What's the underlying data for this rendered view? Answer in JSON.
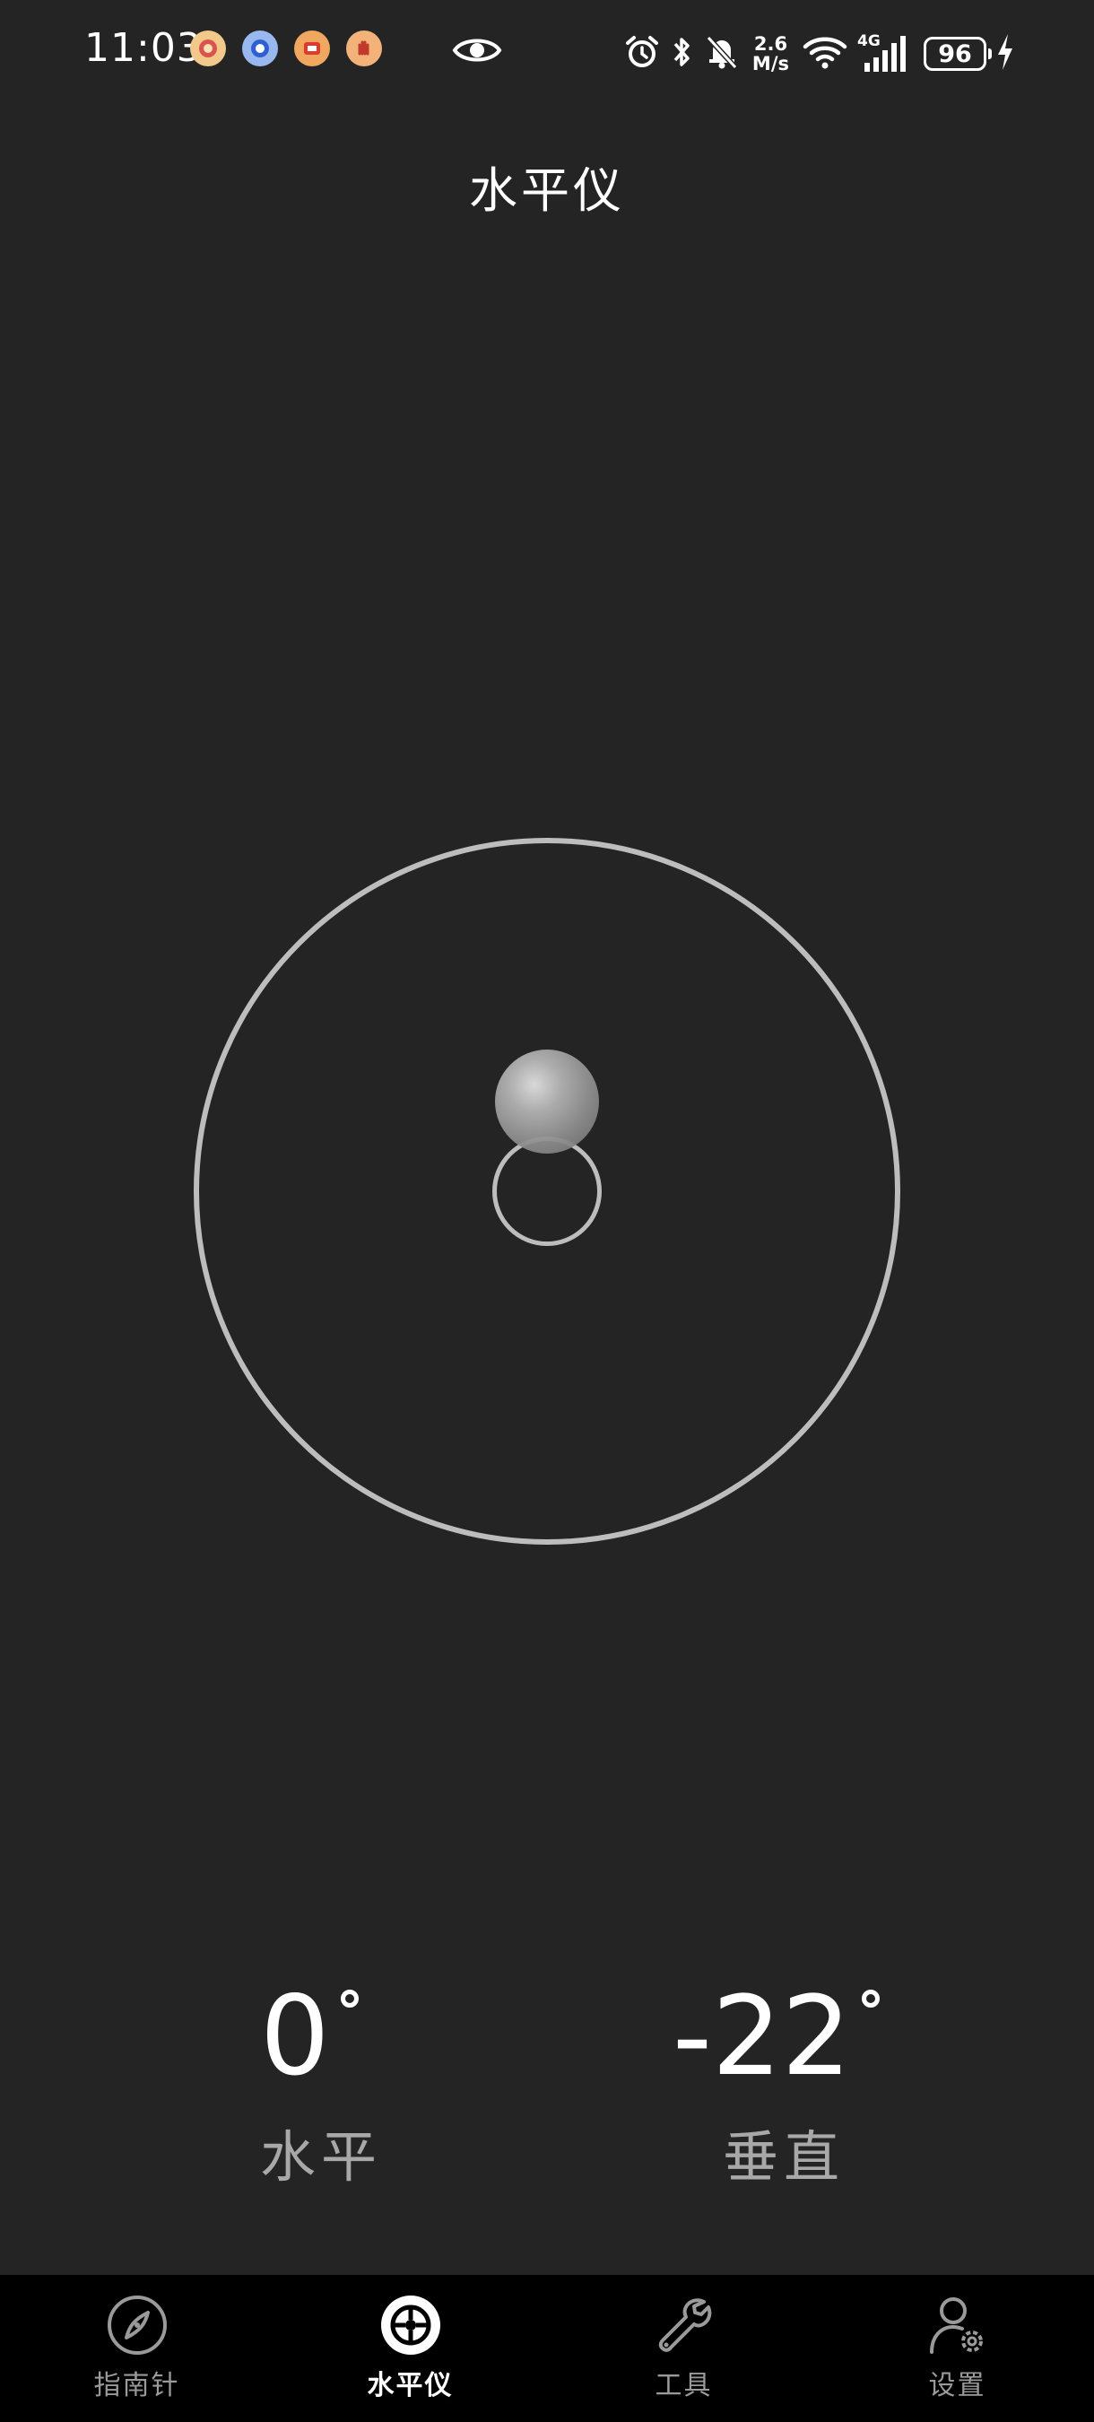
{
  "status_bar": {
    "time": "11:03",
    "net_speed_value": "2.6",
    "net_speed_unit": "M/s",
    "network_type": "4G",
    "battery_level": "96",
    "notification_icons": [
      "app-notification-icon-1",
      "app-notification-icon-2",
      "app-notification-icon-3",
      "app-notification-icon-4"
    ]
  },
  "header": {
    "title": "水平仪"
  },
  "level": {
    "horizontal": {
      "value": "0",
      "label": "水平"
    },
    "vertical": {
      "value": "-22",
      "label": "垂直"
    }
  },
  "bottom_nav": {
    "active_index": 1,
    "items": [
      {
        "label": "指南针",
        "icon": "compass-icon"
      },
      {
        "label": "水平仪",
        "icon": "level-icon"
      },
      {
        "label": "工具",
        "icon": "wrench-icon"
      },
      {
        "label": "设置",
        "icon": "user-settings-icon"
      }
    ]
  },
  "colors": {
    "background": "#242424",
    "nav_background": "#000000",
    "ring": "#bdbdbd",
    "label": "#a8a8a8"
  }
}
